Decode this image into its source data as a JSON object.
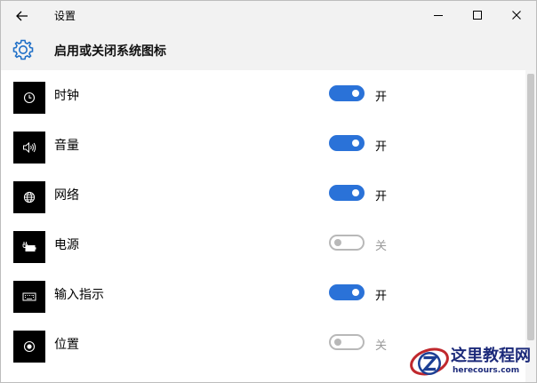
{
  "window": {
    "title": "设置",
    "back_icon": "back-arrow-icon",
    "minimize_icon": "minimize-icon",
    "maximize_icon": "maximize-icon",
    "close_icon": "close-icon"
  },
  "header": {
    "icon": "gear-icon",
    "title": "启用或关闭系统图标"
  },
  "colors": {
    "toggle_on": "#2a72d8",
    "toggle_off": "#b8b8b8",
    "tile_background": "#000000",
    "header_background": "#f2f2f2"
  },
  "items": [
    {
      "label": "时钟",
      "icon": "clock-icon",
      "on": true,
      "state": "开"
    },
    {
      "label": "音量",
      "icon": "volume-icon",
      "on": true,
      "state": "开"
    },
    {
      "label": "网络",
      "icon": "globe-icon",
      "on": true,
      "state": "开"
    },
    {
      "label": "电源",
      "icon": "battery-icon",
      "on": false,
      "state": "关"
    },
    {
      "label": "输入指示",
      "icon": "keyboard-icon",
      "on": true,
      "state": "开"
    },
    {
      "label": "位置",
      "icon": "location-icon",
      "on": false,
      "state": "关"
    }
  ],
  "watermark": {
    "brand": "这里教程网",
    "url": "herecours.com"
  }
}
